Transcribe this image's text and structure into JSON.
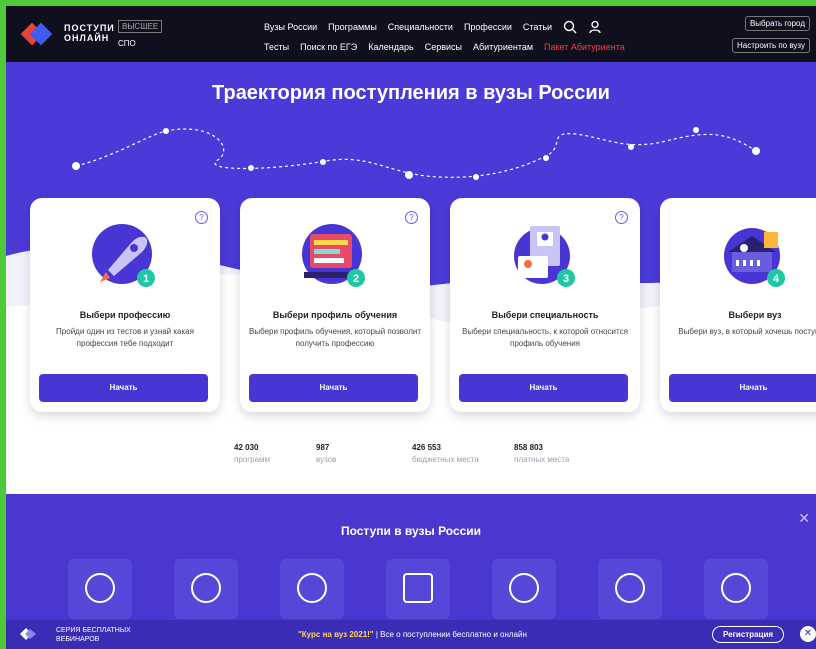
{
  "header": {
    "logo_text_1": "ПОСТУПИ",
    "logo_text_2": "ОНЛАЙН",
    "level_higher": "ВЫСШЕЕ",
    "level_spo": "СПО",
    "nav_row1": [
      "Вузы России",
      "Программы",
      "Специальности",
      "Профессии",
      "Статьи"
    ],
    "nav_row2": [
      "Тесты",
      "Поиск по ЕГЭ",
      "Календарь",
      "Сервисы",
      "Абитуриентам"
    ],
    "nav_highlight": "Пакет Абитуриента",
    "choose_city": "Выбрать город",
    "setup_vuz": "Настроить по вузу",
    "search_icon": "search-icon",
    "user_icon": "user-icon"
  },
  "hero": {
    "title": "Траектория поступления в вузы России"
  },
  "cards": [
    {
      "num": "1",
      "title": "Выбери профессию",
      "desc": "Пройди один из тестов и узнай какая профессия тебе подходит",
      "button": "Начать",
      "icon": "rocket-icon"
    },
    {
      "num": "2",
      "title": "Выбери профиль обучения",
      "desc": "Выбери профиль обучения, который позволит получить профессию",
      "button": "Начать",
      "icon": "monitor-icon"
    },
    {
      "num": "3",
      "title": "Выбери специальность",
      "desc": "Выбери специальность, к которой относится профиль обучения",
      "button": "Начать",
      "icon": "id-card-icon"
    },
    {
      "num": "4",
      "title": "Выбери вуз",
      "desc": "Выбери вуз, в который хочешь поступить",
      "button": "Начать",
      "icon": "university-icon"
    }
  ],
  "stats": [
    {
      "n": "42 030",
      "l": "программ"
    },
    {
      "n": "987",
      "l": "вузов"
    },
    {
      "n": "426 553",
      "l": "бюджетных места"
    },
    {
      "n": "858 803",
      "l": "платных места"
    }
  ],
  "partners": {
    "title": "Поступи в вузы России",
    "close": "✕"
  },
  "bottom": {
    "series_1": "СЕРИЯ БЕСПЛАТНЫХ",
    "series_2": "ВЕБИНАРОВ",
    "promo_highlight": "\"Курс на вуз 2021!\"",
    "promo_text": " | Все о поступлении бесплатно и онлайн",
    "register": "Регистрация",
    "close": "✕"
  },
  "colors": {
    "accent": "#4836d4",
    "background": "#4b3ad8",
    "badge": "#1fc7a5",
    "frame": "#4fc93a"
  }
}
